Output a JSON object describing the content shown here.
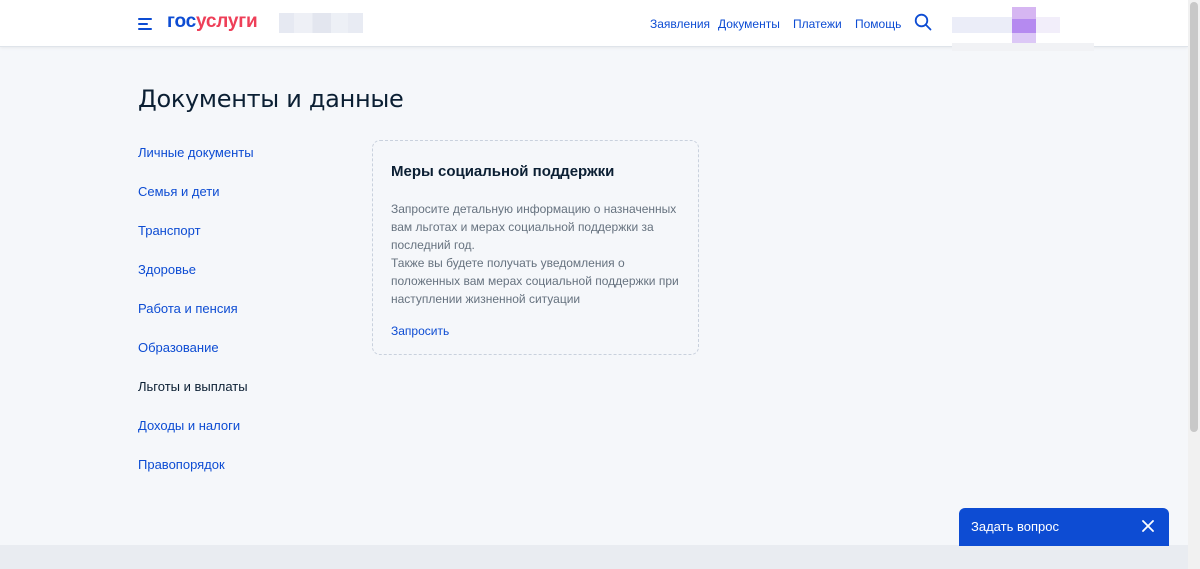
{
  "header": {
    "logo_part1": "гос",
    "logo_part2": "услуги",
    "nav": [
      "Заявления",
      "Документы",
      "Платежи",
      "Помощь"
    ]
  },
  "colors": {
    "brand_blue": "#0d4cd3",
    "brand_red": "#ee3f58",
    "background": "#f5f7fa"
  },
  "main": {
    "title": "Документы и данные",
    "sidebar": [
      {
        "label": "Личные документы"
      },
      {
        "label": "Семья и дети"
      },
      {
        "label": "Транспорт"
      },
      {
        "label": "Здоровье"
      },
      {
        "label": "Работа и пенсия"
      },
      {
        "label": "Образование"
      },
      {
        "label": "Льготы и выплаты",
        "active": true
      },
      {
        "label": "Доходы и налоги"
      },
      {
        "label": "Правопорядок"
      }
    ],
    "card": {
      "title": "Меры социальной поддержки",
      "text_line1": "Запросите детальную информацию о назначенных вам льготах и мерах социальной поддержки за последний год.",
      "text_line2": "Также вы будете получать уведомления о положенных вам мерах социальной поддержки при наступлении жизненной ситуации",
      "link": "Запросить"
    }
  },
  "chat": {
    "label": "Задать вопрос",
    "close_icon": "close-icon"
  }
}
